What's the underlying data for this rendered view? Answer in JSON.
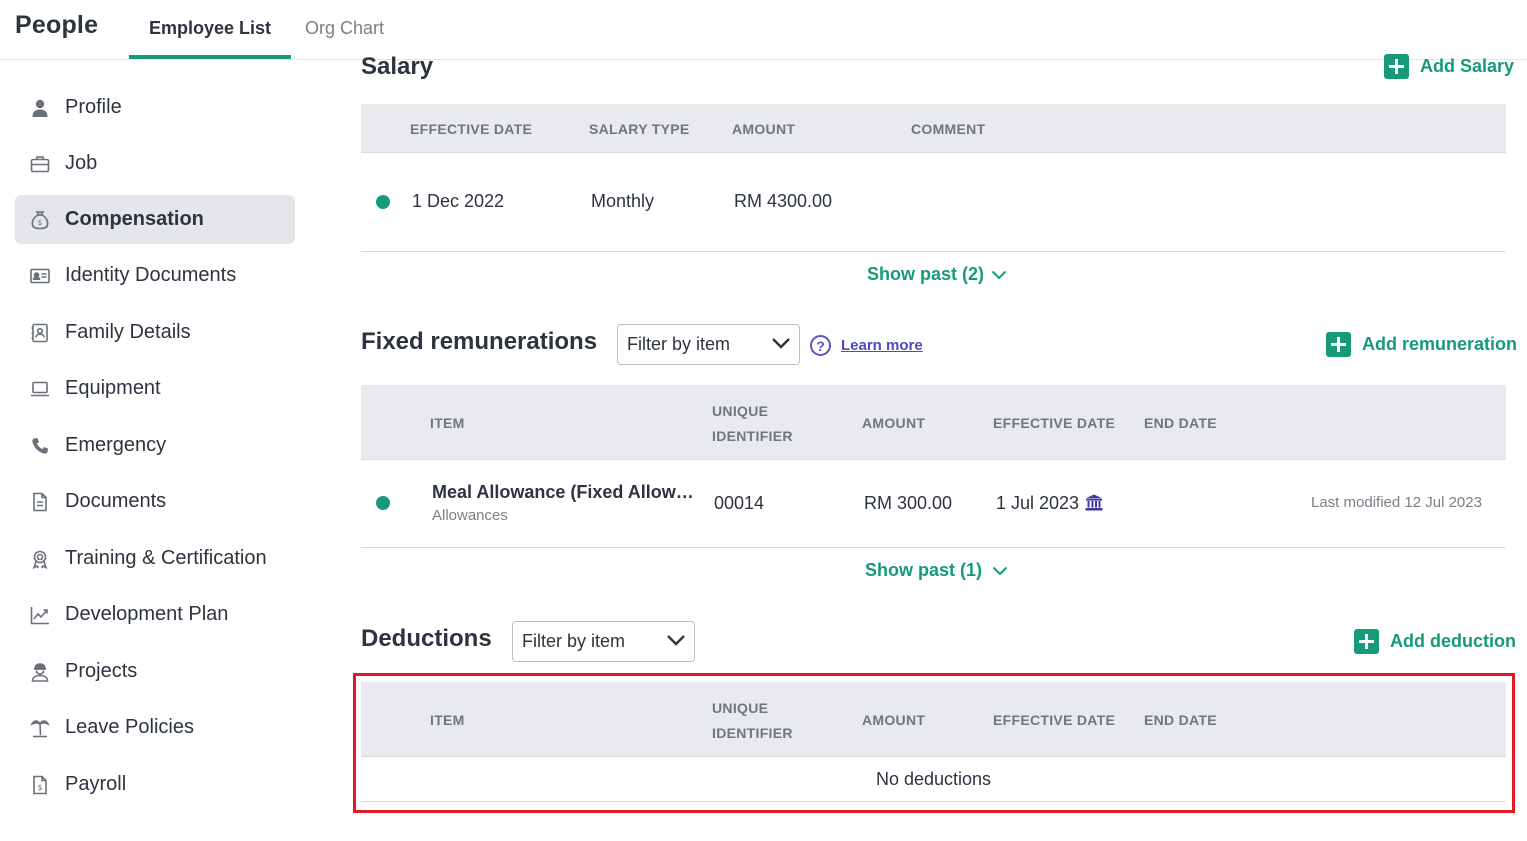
{
  "header": {
    "app_title": "People",
    "tabs": [
      {
        "label": "Employee List",
        "active": true
      },
      {
        "label": "Org Chart",
        "active": false
      }
    ]
  },
  "sidebar": {
    "items": [
      {
        "label": "Profile",
        "icon": "person-icon"
      },
      {
        "label": "Job",
        "icon": "briefcase-icon"
      },
      {
        "label": "Compensation",
        "icon": "money-bag-icon",
        "active": true
      },
      {
        "label": "Identity Documents",
        "icon": "id-card-icon"
      },
      {
        "label": "Family Details",
        "icon": "contact-book-icon"
      },
      {
        "label": "Equipment",
        "icon": "laptop-icon"
      },
      {
        "label": "Emergency",
        "icon": "phone-icon"
      },
      {
        "label": "Documents",
        "icon": "document-icon"
      },
      {
        "label": "Training & Certification",
        "icon": "award-icon"
      },
      {
        "label": "Development Plan",
        "icon": "chart-line-icon"
      },
      {
        "label": "Projects",
        "icon": "worker-icon"
      },
      {
        "label": "Leave Policies",
        "icon": "palm-tree-icon"
      },
      {
        "label": "Payroll",
        "icon": "payslip-icon"
      }
    ]
  },
  "salary": {
    "title": "Salary",
    "add_label": "Add Salary",
    "columns": [
      "EFFECTIVE DATE",
      "SALARY TYPE",
      "AMOUNT",
      "COMMENT"
    ],
    "rows": [
      {
        "effective_date": "1 Dec 2022",
        "salary_type": "Monthly",
        "amount": "RM 4300.00",
        "comment": ""
      }
    ],
    "show_past_label": "Show past (2)"
  },
  "fixed_remunerations": {
    "title": "Fixed remunerations",
    "filter_placeholder": "Filter by item",
    "learn_more_label": "Learn more",
    "add_label": "Add remuneration",
    "columns": [
      "ITEM",
      "UNIQUE",
      "IDENTIFIER",
      "AMOUNT",
      "EFFECTIVE DATE",
      "END DATE"
    ],
    "rows": [
      {
        "item": "Meal Allowance (Fixed Allow…",
        "category": "Allowances",
        "unique_identifier": "00014",
        "amount": "RM 300.00",
        "effective_date": "1 Jul 2023",
        "end_date": "",
        "last_modified": "Last modified 12 Jul 2023"
      }
    ],
    "show_past_label": "Show past (1)"
  },
  "deductions": {
    "title": "Deductions",
    "filter_placeholder": "Filter by item",
    "add_label": "Add deduction",
    "columns": [
      "ITEM",
      "UNIQUE",
      "IDENTIFIER",
      "AMOUNT",
      "EFFECTIVE DATE",
      "END DATE"
    ],
    "empty_message": "No deductions"
  },
  "colors": {
    "accent": "#179a79",
    "link": "#4e4abf",
    "highlight": "#e21b26",
    "active_bg": "#e4e6ea",
    "table_header_bg": "#e8eaed"
  }
}
